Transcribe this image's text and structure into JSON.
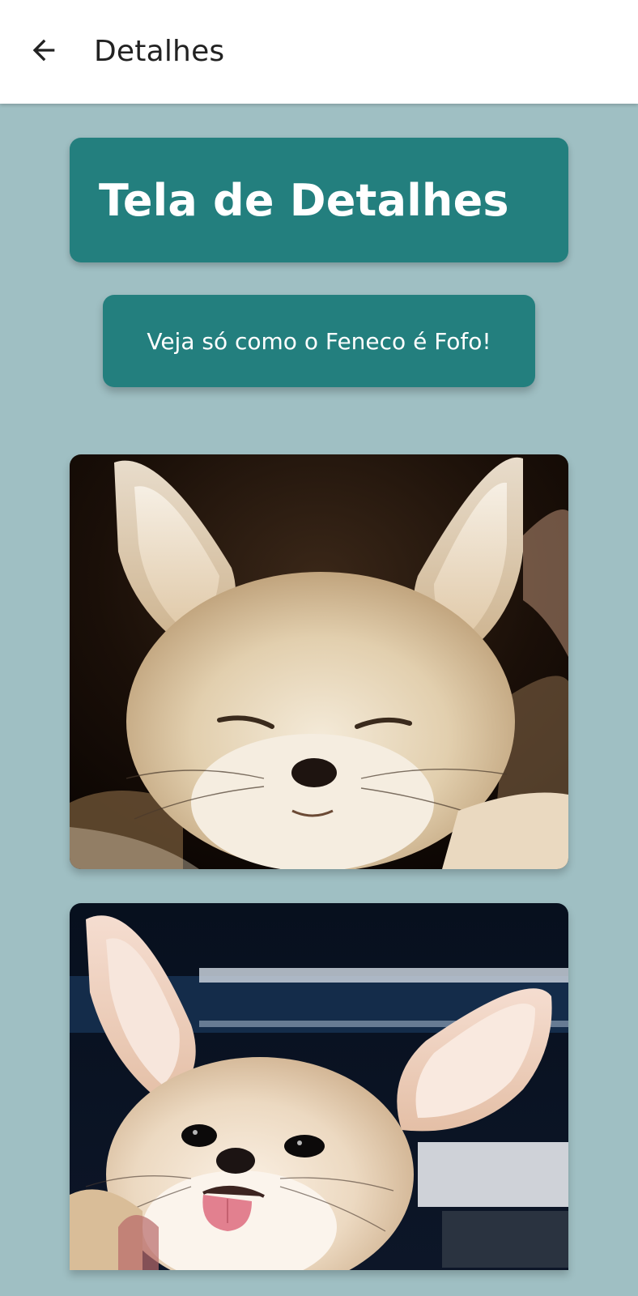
{
  "app_bar": {
    "title": "Detalhes",
    "back_icon": "arrow-left-icon"
  },
  "header_card": {
    "title": "Tela de Detalhes"
  },
  "cta_button": {
    "label": "Veja só como o Feneco é Fofo!"
  },
  "photos": [
    {
      "subject": "fennec-fox-squinting"
    },
    {
      "subject": "fennec-fox-tongue-out"
    }
  ],
  "colors": {
    "background": "#9fbfc3",
    "card": "#237f7e",
    "app_bar": "#ffffff"
  }
}
